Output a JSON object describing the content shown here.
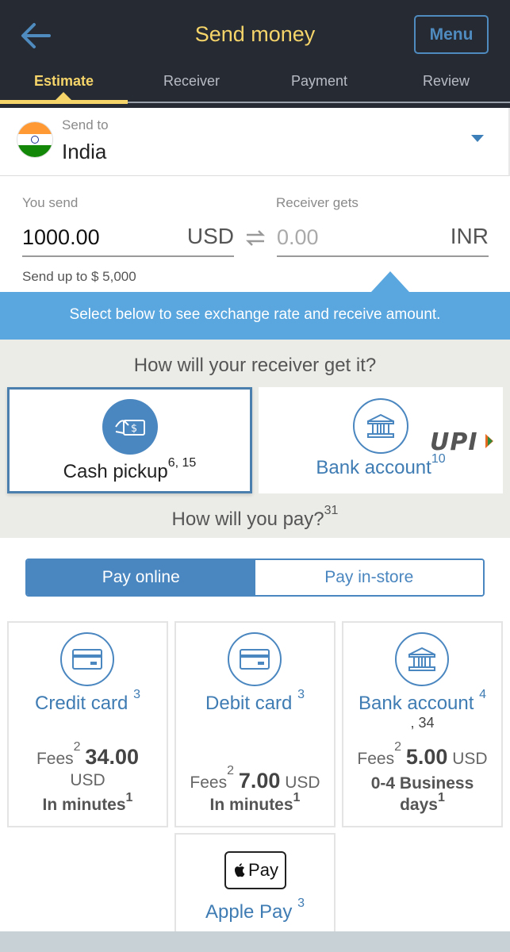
{
  "header": {
    "title": "Send money",
    "menu_label": "Menu"
  },
  "tabs": [
    {
      "label": "Estimate",
      "active": true
    },
    {
      "label": "Receiver",
      "active": false
    },
    {
      "label": "Payment",
      "active": false
    },
    {
      "label": "Review",
      "active": false
    }
  ],
  "destination": {
    "label": "Send to",
    "country": "India",
    "flag": "india-flag-icon"
  },
  "amounts": {
    "send_label": "You send",
    "send_value": "1000.00",
    "send_currency": "USD",
    "receive_label": "Receiver gets",
    "receive_placeholder": "0.00",
    "receive_currency": "INR",
    "limit": "Send up to $ 5,000"
  },
  "info_text": "Select below to see exchange rate and receive amount.",
  "receive_options": {
    "question": "How will your receiver get it?",
    "cash": {
      "label": "Cash pickup",
      "sup": "6, 15",
      "selected": true
    },
    "bank": {
      "label": "Bank account",
      "sup": "10",
      "badge": "UPI"
    }
  },
  "pay": {
    "question": "How will you pay?",
    "question_sup": "31",
    "toggle": {
      "online": "Pay online",
      "instore": "Pay in-store",
      "selected": "online"
    },
    "methods": [
      {
        "name": "Credit card",
        "sup": "3",
        "fee_label": "Fees",
        "fee_sup": "2",
        "fee_amount": "34.00",
        "fee_currency": "USD",
        "time": "In minutes",
        "time_sup": "1"
      },
      {
        "name": "Debit card",
        "sup": "3",
        "fee_label": "Fees",
        "fee_sup": "2",
        "fee_amount": "7.00",
        "fee_currency": "USD",
        "time": "In minutes",
        "time_sup": "1"
      },
      {
        "name": "Bank account",
        "sup": "4",
        "sup2": ", 34",
        "fee_label": "Fees",
        "fee_sup": "2",
        "fee_amount": "5.00",
        "fee_currency": "USD",
        "time_line1": "0-4 Business",
        "time_line2": "days",
        "time_sup": "1"
      },
      {
        "name": "Apple Pay",
        "sup": "3",
        "badge": "Pay"
      }
    ]
  },
  "colors": {
    "header_bg": "#262a33",
    "accent_yellow": "#f5d46a",
    "accent_blue": "#4a86bf",
    "info_blue": "#5aa6de"
  }
}
